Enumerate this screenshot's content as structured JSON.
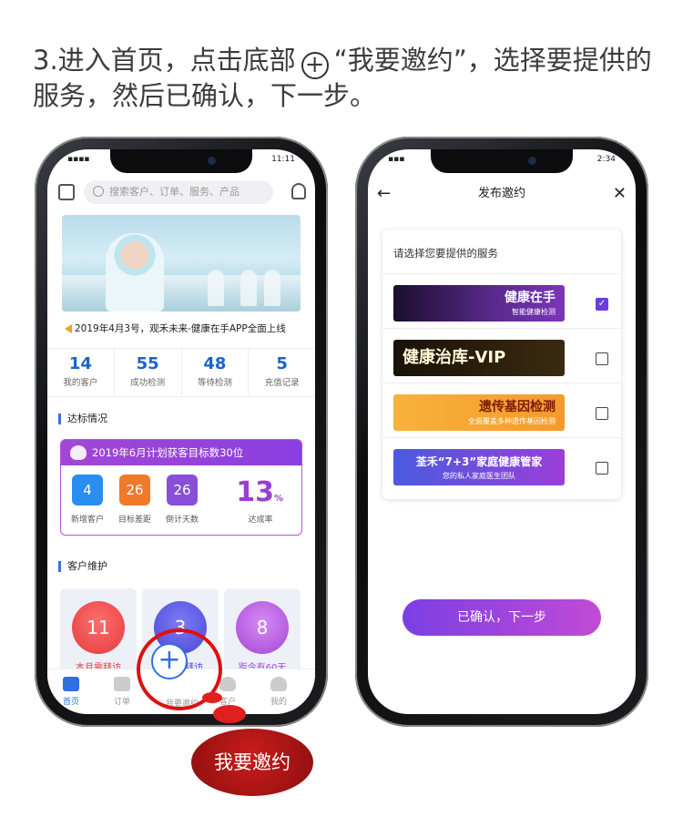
{
  "instruction": {
    "before": "3.进入首页，点击底部",
    "plus": "+",
    "after": "“我要邀约”，选择要提供的服务，然后已确认，下一步。"
  },
  "phone1": {
    "status_left": "▪▪▪▪",
    "status_right": "11:11",
    "search_placeholder": "搜索客户、订单、服务、产品",
    "notice": "2019年4月3号，观禾未来-健康在手APP全面上线",
    "stats": [
      {
        "n": "14",
        "t": "我的客户"
      },
      {
        "n": "55",
        "t": "成功检测"
      },
      {
        "n": "48",
        "t": "等待检测"
      },
      {
        "n": "5",
        "t": "充值记录"
      }
    ],
    "section_goal": "达标情况",
    "goal_title": "2019年6月计划获客目标数30位",
    "goals": [
      {
        "v": "4",
        "t": "新增客户"
      },
      {
        "v": "26",
        "t": "目标差距"
      },
      {
        "v": "26",
        "t": "倒计天数"
      }
    ],
    "rate_value": "13",
    "rate_unit": "%",
    "rate_label": "达成率",
    "section_care": "客户维护",
    "care": [
      {
        "v": "11",
        "t": "本月需拜访"
      },
      {
        "v": "3",
        "t": "本周需拜访"
      },
      {
        "v": "8",
        "t": "距今有60天"
      }
    ],
    "tabs": [
      "首页",
      "订单",
      "我要邀约",
      "客户",
      "我的"
    ],
    "bubble": "我要邀约",
    "colors": {
      "primary": "#2f6fe0",
      "purple": "#9b3fcf",
      "highlight": "#e01010"
    }
  },
  "phone2": {
    "status_left": "▪▪▪",
    "status_right": "2:34",
    "title": "发布邀约",
    "back_icon": "←",
    "close_icon": "✕",
    "prompt": "请选择您要提供的服务",
    "services": [
      {
        "name": "健康在手",
        "sub": "智能健康检测",
        "checked": true
      },
      {
        "name": "健康治库-VIP",
        "sub": "",
        "checked": false
      },
      {
        "name": "遗传基因检测",
        "sub": "全面覆盖多种遗传基因检测",
        "checked": false
      },
      {
        "name": "荃禾“7+3”家庭健康管家",
        "sub": "您的私人家庭医生团队",
        "checked": false
      }
    ],
    "confirm": "已确认，下一步"
  }
}
